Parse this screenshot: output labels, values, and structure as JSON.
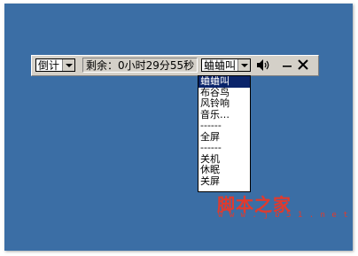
{
  "toolbar": {
    "mode_select": "倒计",
    "remaining_label": "剩余：0小时29分55秒",
    "sound_select": "蛐蛐叫",
    "volume_icon": "speaker-icon",
    "minimize_glyph": "−",
    "close_glyph": "✕"
  },
  "dropdown": {
    "items": [
      "蛐蛐叫",
      "布谷鸟",
      "风铃响",
      "音乐…",
      "------",
      "全屏",
      "------",
      "关机",
      "休眠",
      "关屏"
    ]
  },
  "watermark": {
    "title": "脚本之家",
    "url": "w w w . j b 5 1 . n e t"
  },
  "colors": {
    "desktop": "#3b6ea5",
    "selection": "#0a246a",
    "watermark": "#e23a2c"
  }
}
